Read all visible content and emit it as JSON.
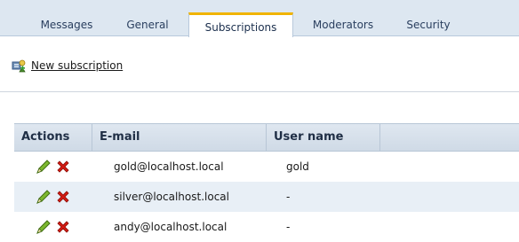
{
  "tabs": [
    {
      "label": "Messages"
    },
    {
      "label": "General"
    },
    {
      "label": "Subscriptions",
      "active": true
    },
    {
      "label": "Moderators"
    },
    {
      "label": "Security"
    }
  ],
  "toolbar": {
    "new_subscription_label": "New subscription",
    "new_subscription_icon": "new-subscription-icon"
  },
  "grid": {
    "headers": {
      "actions": "Actions",
      "email": "E-mail",
      "username": "User name"
    },
    "rows": [
      {
        "email": "gold@localhost.local",
        "username": "gold"
      },
      {
        "email": "silver@localhost.local",
        "username": "-"
      },
      {
        "email": "andy@localhost.local",
        "username": "-"
      }
    ],
    "row_icons": [
      "edit-pencil-icon",
      "delete-x-icon"
    ]
  },
  "colors": {
    "tab_strip": "#dde7f1",
    "active_tab_accent": "#f0b400",
    "header_bg": "#d6e0ea",
    "alt_row": "#e8eff6",
    "delete_red": "#d41b12",
    "pencil_green": "#6aa61e"
  }
}
